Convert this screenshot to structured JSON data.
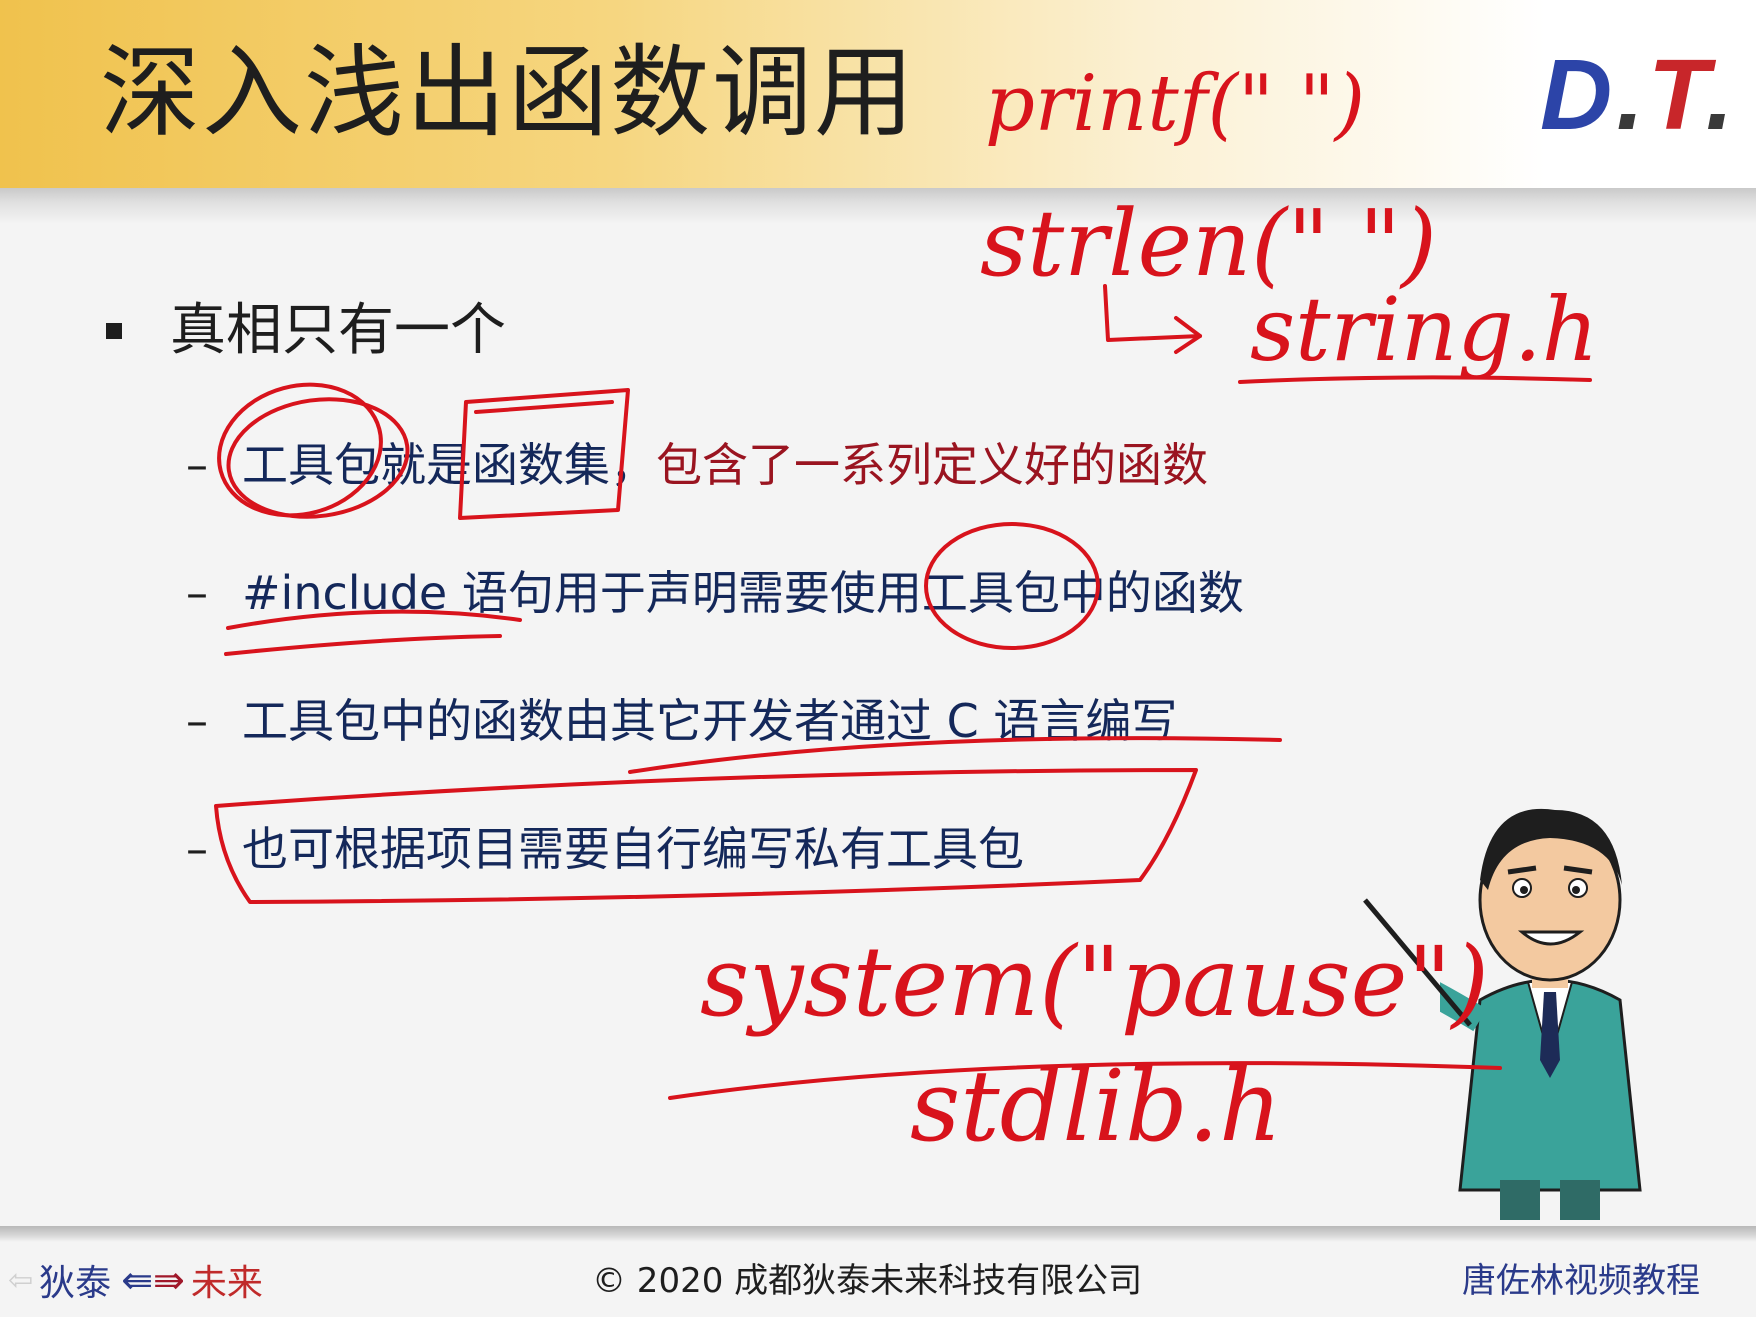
{
  "slide": {
    "title": "深入浅出函数调用",
    "logo": {
      "d": "D",
      "dot1": ".",
      "t": "T",
      "dot2": "."
    },
    "main_bullet": "真相只有一个",
    "sub_bullets": [
      {
        "text": "工具包就是函数集，",
        "red_text": "包含了一系列定义好的函数"
      },
      {
        "text": "#include 语句用于声明需要使用工具包中的函数",
        "red_text": ""
      },
      {
        "text": "工具包中的函数由其它开发者通过 C 语言编写",
        "red_text": ""
      },
      {
        "text": "也可根据项目需要自行编写私有工具包",
        "red_text": ""
      }
    ],
    "dash": "–"
  },
  "handwriting": {
    "line1": "printf(\"  \")",
    "line2": "strlen(\"  \")",
    "line3": "string.h",
    "line4": "system(\"pause\")",
    "line5": "stdlib.h"
  },
  "footer": {
    "left_a": "狄泰",
    "left_b": "未来",
    "center": "© 2020 成都狄泰未来科技有限公司",
    "right": "唐佐林视频教程"
  },
  "colors": {
    "title_bar": "#f0c24d",
    "text_navy": "#14285a",
    "text_red": "#9a1420",
    "ink_red": "#d8131c",
    "logo_blue": "#2c44a8",
    "logo_red": "#c8262a"
  }
}
